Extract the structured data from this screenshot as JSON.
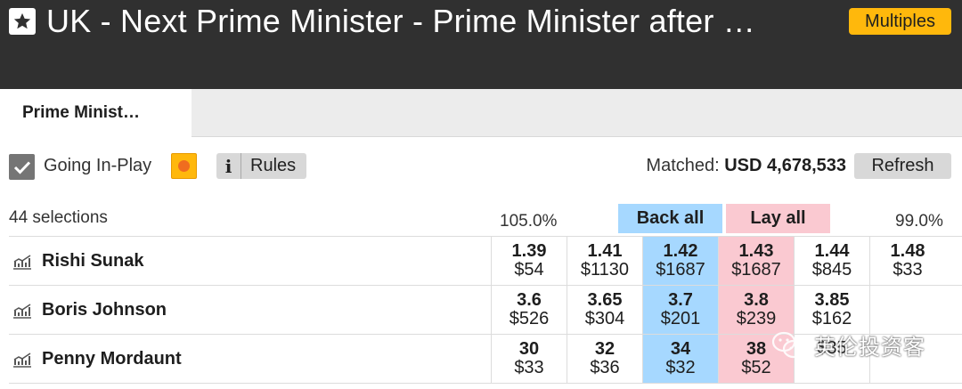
{
  "header": {
    "title": "UK - Next Prime Minister - Prime Minister after …",
    "multiples_label": "Multiples",
    "favourite_icon": "star-icon"
  },
  "tabs": [
    {
      "label": "Prime Minist…",
      "active": true
    }
  ],
  "toolbar": {
    "going_inplay_label": "Going In-Play",
    "going_inplay_checked": true,
    "rules_icon": "i",
    "rules_label": "Rules",
    "matched_label": "Matched:",
    "matched_value": "USD 4,678,533",
    "refresh_label": "Refresh"
  },
  "market": {
    "selections_label": "44 selections",
    "back_book_pct": "105.0%",
    "lay_book_pct": "99.0%",
    "back_all_label": "Back all",
    "lay_all_label": "Lay all",
    "colors": {
      "back": "#a6d8ff",
      "lay": "#fac9d1",
      "header": "#303030",
      "accent": "#ffb80c"
    }
  },
  "runners": [
    {
      "name": "Rishi Sunak",
      "back": [
        {
          "price": "1.39",
          "size": "$54"
        },
        {
          "price": "1.41",
          "size": "$1130"
        },
        {
          "price": "1.42",
          "size": "$1687"
        }
      ],
      "lay": [
        {
          "price": "1.43",
          "size": "$1687"
        },
        {
          "price": "1.44",
          "size": "$845"
        },
        {
          "price": "1.48",
          "size": "$33"
        }
      ]
    },
    {
      "name": "Boris Johnson",
      "back": [
        {
          "price": "3.6",
          "size": "$526"
        },
        {
          "price": "3.65",
          "size": "$304"
        },
        {
          "price": "3.7",
          "size": "$201"
        }
      ],
      "lay": [
        {
          "price": "3.8",
          "size": "$239"
        },
        {
          "price": "3.85",
          "size": "$162"
        },
        {
          "price": "",
          "size": ""
        }
      ]
    },
    {
      "name": "Penny Mordaunt",
      "back": [
        {
          "price": "30",
          "size": "$33"
        },
        {
          "price": "32",
          "size": "$36"
        },
        {
          "price": "34",
          "size": "$32"
        }
      ],
      "lay": [
        {
          "price": "38",
          "size": "$52"
        },
        {
          "price": "",
          "size": "$35"
        },
        {
          "price": "",
          "size": ""
        }
      ]
    }
  ],
  "watermark": {
    "text": "英伦投资客",
    "icon": "wechat-icon"
  }
}
